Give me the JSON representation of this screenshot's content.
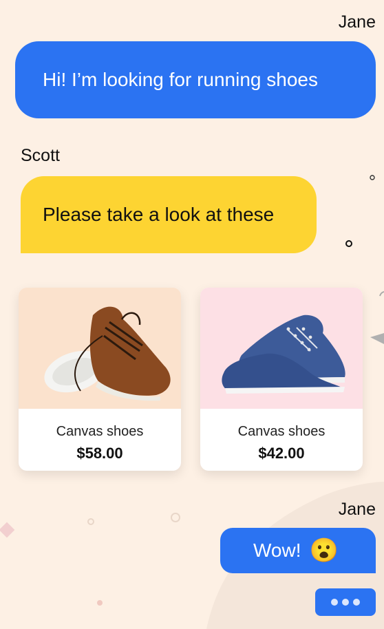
{
  "messages": [
    {
      "sender": "Jane",
      "text": "Hi! I’m looking for running shoes"
    },
    {
      "sender": "Scott",
      "text": "Please take a look at these"
    },
    {
      "sender": "Jane",
      "text": "Wow!",
      "emoji": "😮"
    }
  ],
  "products": [
    {
      "name": "Canvas shoes",
      "price": "$58.00",
      "image_icon": "brown-shoe-icon"
    },
    {
      "name": "Canvas shoes",
      "price": "$42.00",
      "image_icon": "blue-shoe-icon"
    }
  ],
  "typing_indicator": {
    "dots": 3
  },
  "colors": {
    "background": "#fdf0e4",
    "blue_bubble": "#2b73f2",
    "yellow_bubble": "#fdd432",
    "card_bg_1": "#fbe2cd",
    "card_bg_2": "#fde0e5"
  }
}
